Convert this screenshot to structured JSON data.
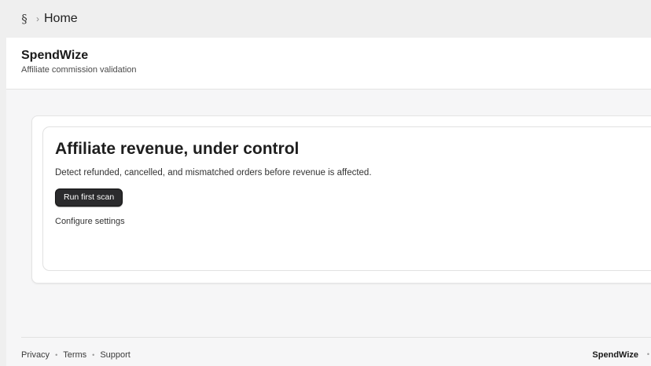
{
  "topbar": {
    "app_icon_glyph": "§",
    "separator": "›",
    "breadcrumb_title": "Home"
  },
  "app_header": {
    "name": "SpendWize",
    "tagline": "Affiliate commission validation"
  },
  "hero": {
    "title": "Affiliate revenue, under control",
    "description": "Detect refunded, cancelled, and mismatched orders before revenue is affected.",
    "primary_button": "Run first scan",
    "secondary_link": "Configure settings"
  },
  "footer": {
    "links": [
      {
        "label": "Privacy"
      },
      {
        "label": "Terms"
      },
      {
        "label": "Support"
      }
    ],
    "separator": "•",
    "brand": "SpendWize"
  },
  "icons": {
    "app_icon": "app-logo-icon",
    "breadcrumb_separator": "chevron-right-icon"
  },
  "colors": {
    "primary_button_bg": "#2b2b2d",
    "primary_button_text": "#ffffff",
    "surface": "#f6f6f7",
    "card": "#ffffff"
  }
}
